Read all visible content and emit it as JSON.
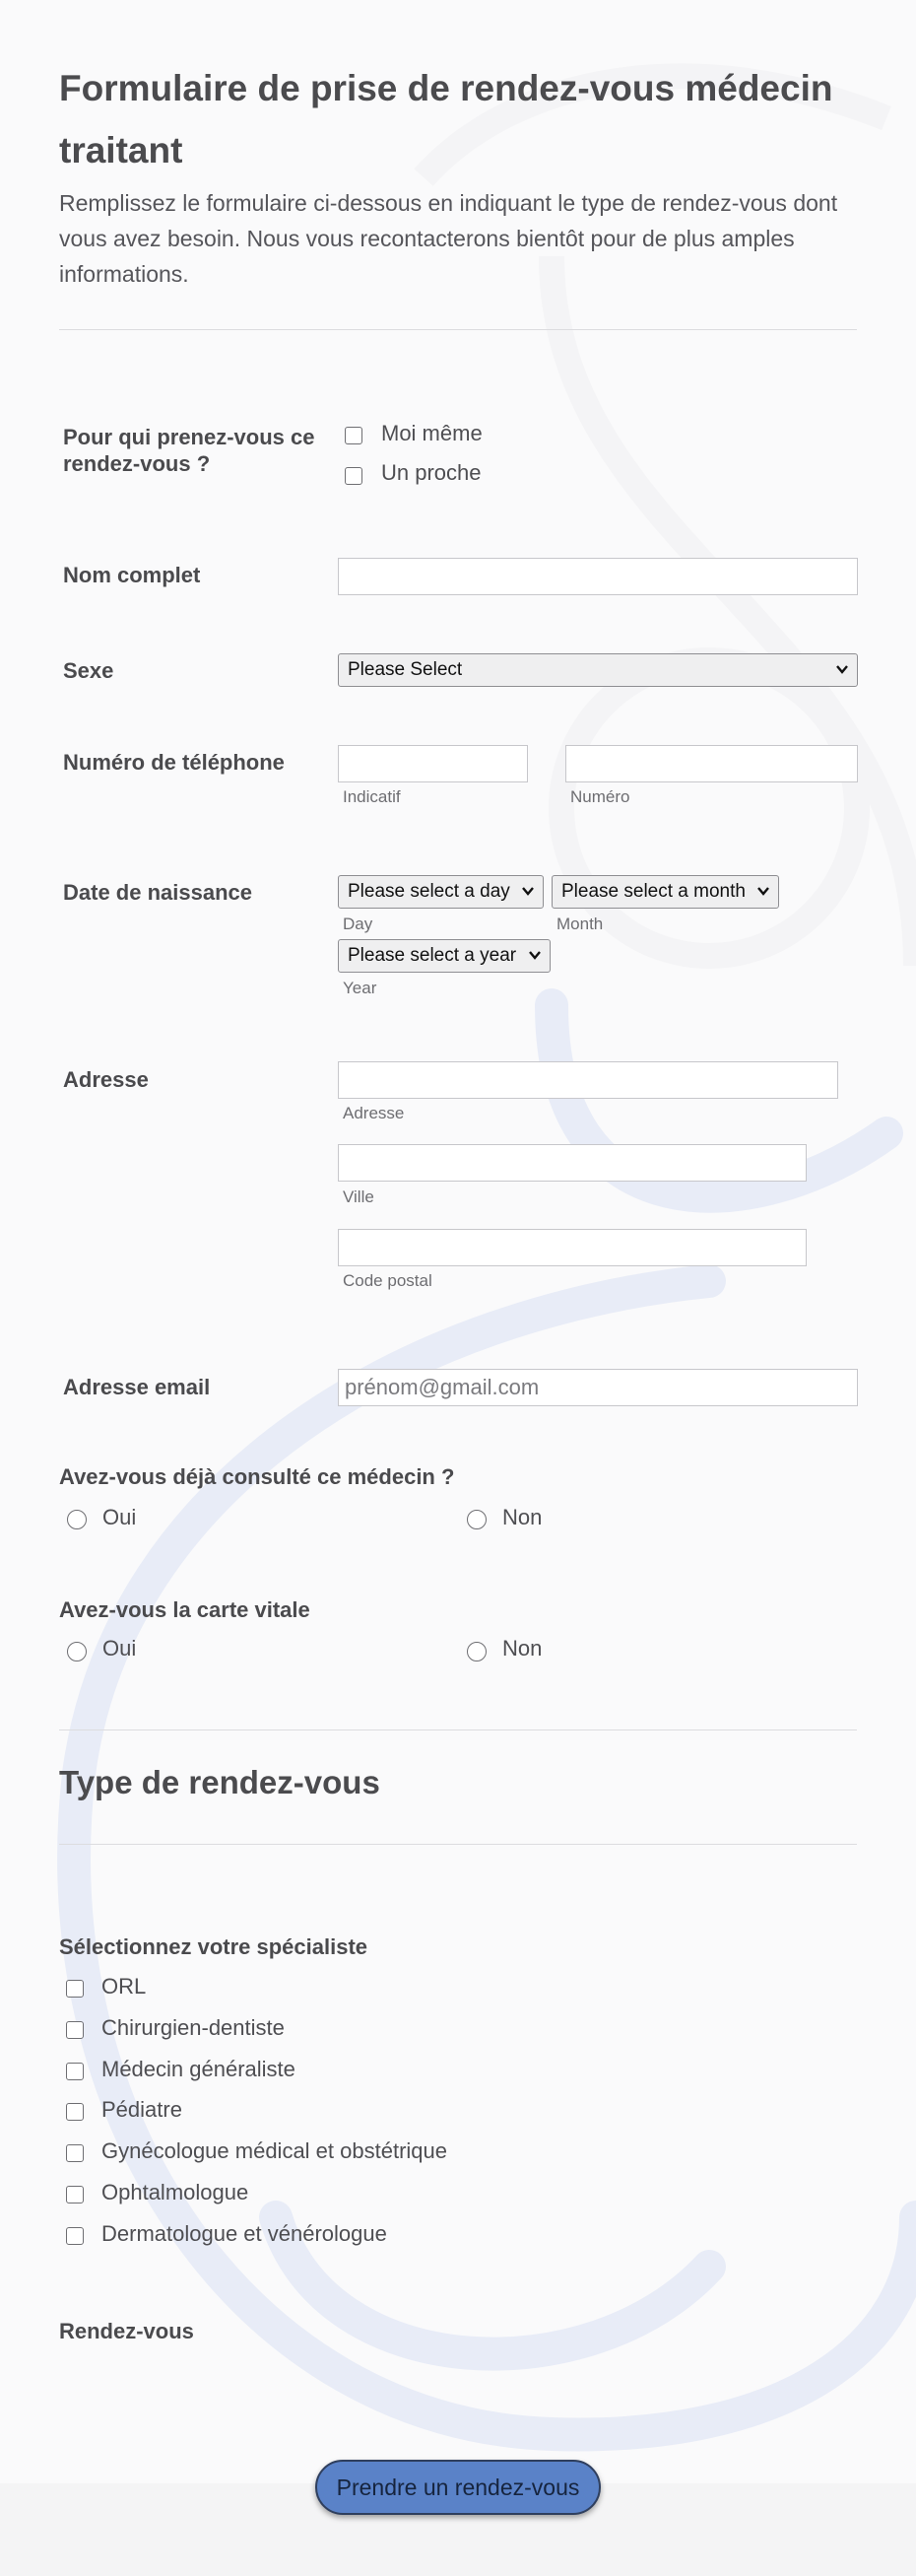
{
  "header": {
    "title": "Formulaire de prise de rendez-vous médecin traitant",
    "subtitle": "Remplissez le formulaire ci-dessous en indiquant le type de rendez-vous dont vous avez besoin. Nous vous recontacterons bientôt pour de plus amples informations."
  },
  "who": {
    "label": "Pour qui prenez-vous ce rendez-vous ?",
    "options": [
      "Moi même",
      "Un proche"
    ]
  },
  "fullname": {
    "label": "Nom complet",
    "value": ""
  },
  "sex": {
    "label": "Sexe",
    "selected": "Please Select"
  },
  "phone": {
    "label": "Numéro de téléphone",
    "sub_code": "Indicatif",
    "sub_number": "Numéro"
  },
  "birth": {
    "label": "Date de naissance",
    "day_select": "Please select a day",
    "month_select": "Please select a month",
    "year_select": "Please select a year",
    "sub_day": "Day",
    "sub_month": "Month",
    "sub_year": "Year"
  },
  "address": {
    "label": "Adresse",
    "sub_address": "Adresse",
    "sub_city": "Ville",
    "sub_zip": "Code postal"
  },
  "email": {
    "label": "Adresse email",
    "placeholder": "prénom@gmail.com"
  },
  "consulted": {
    "label": "Avez-vous déjà consulté ce médecin ?",
    "yes": "Oui",
    "no": "Non"
  },
  "vitale": {
    "label": "Avez-vous la carte vitale",
    "yes": "Oui",
    "no": "Non"
  },
  "section2": {
    "title": "Type de rendez-vous"
  },
  "specialist": {
    "label": "Sélectionnez votre spécialiste",
    "options": [
      "ORL",
      "Chirurgien-dentiste",
      "Médecin généraliste",
      "Pédiatre",
      "Gynécologue médical et obstétrique",
      "Ophtalmologue",
      "Dermatologue et vénérologue"
    ]
  },
  "appointment": {
    "label": "Rendez-vous"
  },
  "submit": {
    "label": "Prendre un rendez-vous"
  },
  "colors": {
    "accent": "#5a82c8",
    "background_motif": "#c9d4ef"
  }
}
